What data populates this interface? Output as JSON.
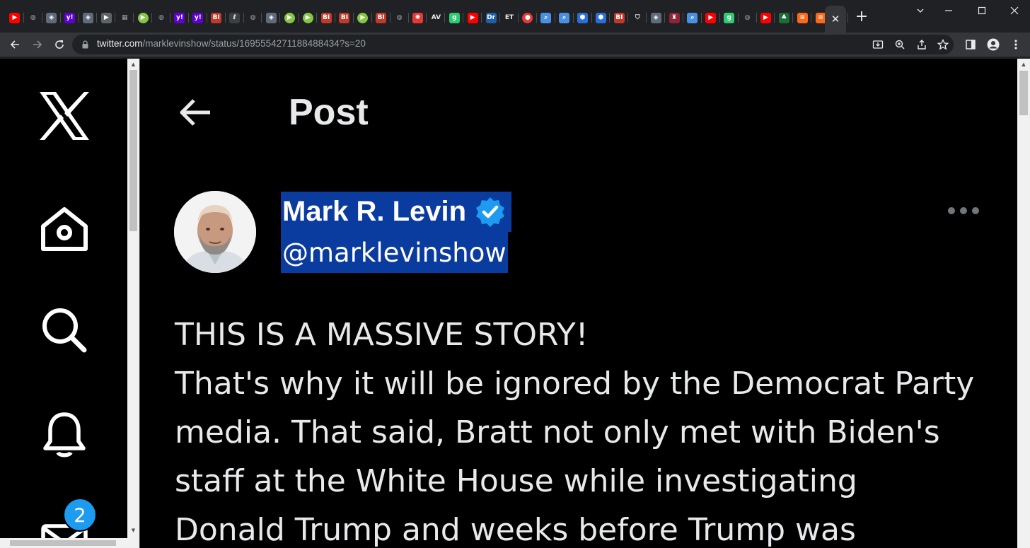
{
  "browser": {
    "tabs": [
      {
        "icon": "youtube-icon",
        "color": "#ff0000",
        "glyph": "▶"
      },
      {
        "icon": "globe-icon",
        "color": "#9aa0a6",
        "glyph": "◍"
      },
      {
        "icon": "shield-icon",
        "color": "#5f6b7a",
        "glyph": "◈"
      },
      {
        "icon": "yahoo-icon",
        "color": "#6001d2",
        "glyph": "y!"
      },
      {
        "icon": "shield-icon",
        "color": "#5f6b7a",
        "glyph": "◈"
      },
      {
        "icon": "flag-icon",
        "color": "#5f6368",
        "glyph": "▶"
      },
      {
        "icon": "doc-icon",
        "color": "#9aa0a6",
        "glyph": "▦"
      },
      {
        "icon": "rumble-icon",
        "color": "#85c742",
        "glyph": "▶"
      },
      {
        "icon": "globe-icon",
        "color": "#9aa0a6",
        "glyph": "◍"
      },
      {
        "icon": "yahoo-icon",
        "color": "#6001d2",
        "glyph": "y!"
      },
      {
        "icon": "yahoo-icon",
        "color": "#6001d2",
        "glyph": "y!"
      },
      {
        "icon": "bi-icon",
        "color": "#c0392b",
        "glyph": "BI"
      },
      {
        "icon": "article-icon",
        "color": "#3c4043",
        "glyph": "ℓ"
      },
      {
        "icon": "globe-icon",
        "color": "#9aa0a6",
        "glyph": "◍"
      },
      {
        "icon": "shield-icon",
        "color": "#5f6b7a",
        "glyph": "◈"
      },
      {
        "icon": "rumble-icon",
        "color": "#85c742",
        "glyph": "▶"
      },
      {
        "icon": "rumble-icon",
        "color": "#85c742",
        "glyph": "▶"
      },
      {
        "icon": "bi-icon",
        "color": "#c0392b",
        "glyph": "BI"
      },
      {
        "icon": "bi-icon",
        "color": "#c0392b",
        "glyph": "BI"
      },
      {
        "icon": "rumble-icon",
        "color": "#85c742",
        "glyph": "▶"
      },
      {
        "icon": "bi-icon",
        "color": "#c0392b",
        "glyph": "BI"
      },
      {
        "icon": "globe-icon",
        "color": "#9aa0a6",
        "glyph": "◍"
      },
      {
        "icon": "burst-icon",
        "color": "#e53935",
        "glyph": "✺"
      },
      {
        "icon": "news-icon",
        "color": "#e8eaed",
        "glyph": "AV"
      },
      {
        "icon": "g-icon",
        "color": "#2ecc71",
        "glyph": "g"
      },
      {
        "icon": "youtube-icon",
        "color": "#ff0000",
        "glyph": "▶"
      },
      {
        "icon": "dr-icon",
        "color": "#1e5fa8",
        "glyph": "Dr"
      },
      {
        "icon": "et-icon",
        "color": "#e8eaed",
        "glyph": "ET"
      },
      {
        "icon": "mic-icon",
        "color": "#e53935",
        "glyph": "●"
      },
      {
        "icon": "search-icon",
        "color": "#4a90e2",
        "glyph": "⌕"
      },
      {
        "icon": "search-icon",
        "color": "#4a90e2",
        "glyph": "⌕"
      },
      {
        "icon": "cube-icon",
        "color": "#2a6fd6",
        "glyph": "⬢"
      },
      {
        "icon": "cube-icon",
        "color": "#2a6fd6",
        "glyph": "⬢"
      },
      {
        "icon": "bi-icon",
        "color": "#c0392b",
        "glyph": "BI"
      },
      {
        "icon": "shield-outline-icon",
        "color": "#e8eaed",
        "glyph": "⛉"
      },
      {
        "icon": "shield-icon",
        "color": "#5f6b7a",
        "glyph": "◈"
      },
      {
        "icon": "crest-icon",
        "color": "#8e2436",
        "glyph": "♜"
      },
      {
        "icon": "search-icon",
        "color": "#4a90e2",
        "glyph": "⌕"
      },
      {
        "icon": "youtube-icon",
        "color": "#ff0000",
        "glyph": "▶"
      },
      {
        "icon": "g-icon",
        "color": "#2ecc71",
        "glyph": "g"
      },
      {
        "icon": "globe-icon",
        "color": "#9aa0a6",
        "glyph": "◍"
      },
      {
        "icon": "youtube-icon",
        "color": "#ff0000",
        "glyph": "▶"
      },
      {
        "icon": "leaf-icon",
        "color": "#1b6e3a",
        "glyph": "♣"
      },
      {
        "icon": "substack-icon",
        "color": "#ff6719",
        "glyph": "≡"
      },
      {
        "icon": "substack-icon",
        "color": "#ff6719",
        "glyph": "≡"
      },
      {
        "icon": "flag-icon",
        "color": "#7b3fe4",
        "glyph": "⚑"
      }
    ],
    "url_host": "twitter.com",
    "url_path": "/marklevinshow/status/1695554271188488434?s=20",
    "new_tab_glyph": "+",
    "close_glyph": "✕"
  },
  "post": {
    "header_title": "Post",
    "author_name": "Mark R. Levin",
    "author_handle": "@marklevinshow",
    "text": "THIS IS A MASSIVE STORY!\nThat's why it will be ignored by the Democrat Party\nmedia.  That said, Bratt not only met with Biden's\nstaff at the White House while investigating\nDonald Trump and weeks before Trump was"
  },
  "sidebar": {
    "messages_badge": "2"
  },
  "colors": {
    "accent": "#1d9bf0",
    "selection": "#0a3b9e",
    "background": "#000000",
    "text": "#e7e9ea"
  }
}
